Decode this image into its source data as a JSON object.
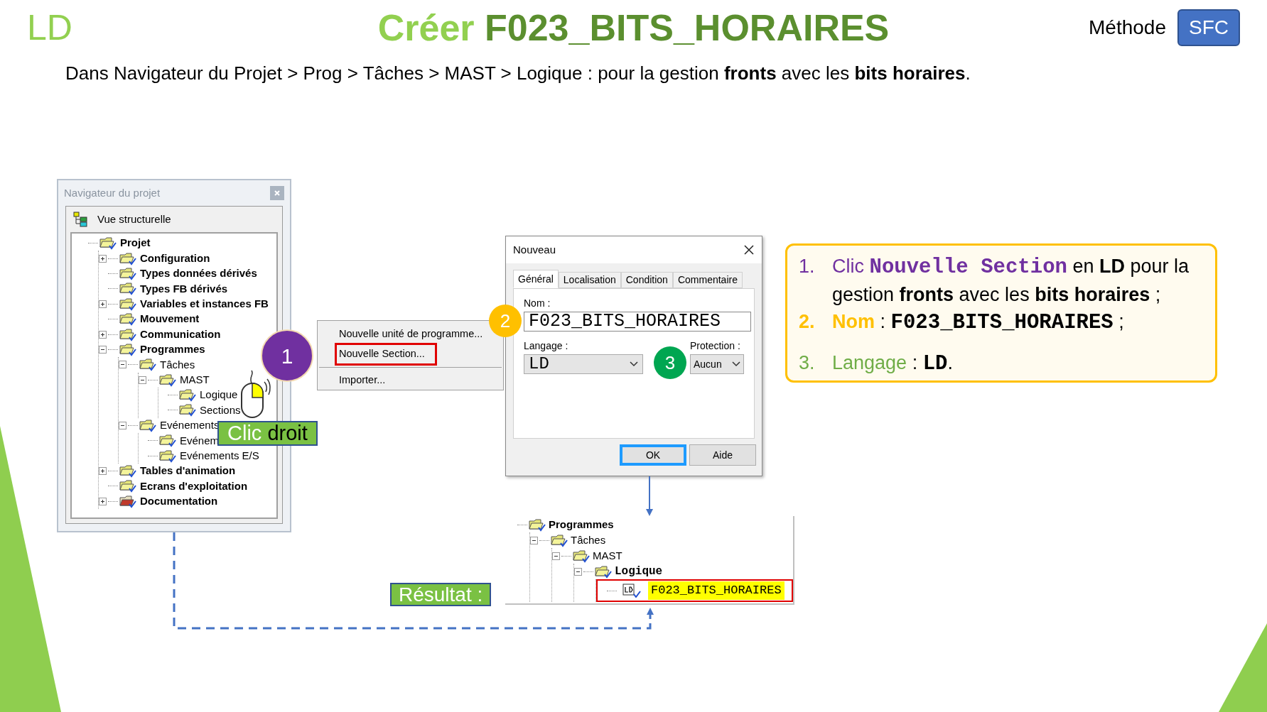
{
  "header": {
    "corner_label": "LD",
    "title_prefix": "Créer",
    "title_name": "F023_BITS_HORAIRES",
    "method_label": "Méthode",
    "method_button": "SFC"
  },
  "subtitle": "Dans Navigateur du Projet > Prog > Tâches > MAST > Logique : pour la gestion **fronts** avec les **bits horaires**.",
  "navigator": {
    "title": "Navigateur du projet",
    "view_label": "Vue structurelle",
    "tree": [
      {
        "label": "Projet",
        "kind": "folder",
        "collapsed": false,
        "children": [
          {
            "label": "Configuration",
            "kind": "folder",
            "collapsed": true
          },
          {
            "label": "Types données dérivés",
            "kind": "folder",
            "collapsed": false
          },
          {
            "label": "Types FB dérivés",
            "kind": "folder",
            "collapsed": false
          },
          {
            "label": "Variables et instances FB",
            "kind": "folder",
            "collapsed": true
          },
          {
            "label": "Mouvement",
            "kind": "folder",
            "collapsed": false
          },
          {
            "label": "Communication",
            "kind": "folder",
            "collapsed": true
          },
          {
            "label": "Programmes",
            "kind": "folder",
            "collapsed": false,
            "children": [
              {
                "label": "Tâches",
                "kind": "folder",
                "collapsed": false,
                "children": [
                  {
                    "label": "MAST",
                    "kind": "folder",
                    "collapsed": false,
                    "children": [
                      {
                        "label": "Logique",
                        "kind": "folder",
                        "collapsed": false
                      },
                      {
                        "label": "Sections",
                        "kind": "folder",
                        "collapsed": false
                      }
                    ]
                  }
                ]
              },
              {
                "label": "Evénements",
                "kind": "folder",
                "collapsed": false,
                "children": [
                  {
                    "label": "Evénem",
                    "kind": "folder",
                    "collapsed": false
                  },
                  {
                    "label": "Evénements E/S",
                    "kind": "folder",
                    "collapsed": false
                  }
                ]
              }
            ]
          },
          {
            "label": "Tables d'animation",
            "kind": "folder",
            "collapsed": true
          },
          {
            "label": "Ecrans d'exploitation",
            "kind": "folder",
            "collapsed": false
          },
          {
            "label": "Documentation",
            "kind": "documentation",
            "collapsed": true
          }
        ]
      }
    ]
  },
  "context_menu": {
    "items": [
      {
        "label": "Nouvelle unité de programme...",
        "highlighted": false,
        "separator_before": false
      },
      {
        "label": "Nouvelle Section...",
        "highlighted": true,
        "separator_before": false
      },
      {
        "label": "Importer...",
        "highlighted": false,
        "separator_before": true
      }
    ]
  },
  "dialog": {
    "title": "Nouveau",
    "tabs": [
      {
        "label": "Général",
        "selected": true
      },
      {
        "label": "Localisation",
        "selected": false
      },
      {
        "label": "Condition",
        "selected": false
      },
      {
        "label": "Commentaire",
        "selected": false
      }
    ],
    "name_label": "Nom :",
    "name_value": "F023_BITS_HORAIRES",
    "language_label": "Langage :",
    "language_value": "LD",
    "protection_label": "Protection :",
    "protection_value": "Aucun",
    "buttons": [
      {
        "label": "OK",
        "focused": true
      },
      {
        "label": "Aide",
        "focused": false
      }
    ]
  },
  "badges": [
    {
      "number": "1",
      "color": "#7030a0"
    },
    {
      "number": "2",
      "color": "#ffc000"
    },
    {
      "number": "3",
      "color": "#00a651"
    }
  ],
  "right_click_label": {
    "first": "Clic",
    "second": "droit"
  },
  "result_label": "Résultat :",
  "result_tree": [
    {
      "label": "Programmes",
      "kind": "folder",
      "collapsed": false,
      "highlighted": false,
      "children": [
        {
          "label": "Tâches",
          "kind": "folder",
          "collapsed": false,
          "highlighted": false,
          "children": [
            {
              "label": "MAST",
              "kind": "folder",
              "collapsed": false,
              "highlighted": false,
              "children": [
                {
                  "label": "Logique",
                  "kind": "folder",
                  "collapsed": false,
                  "highlighted": false,
                  "children": [
                    {
                      "label": "F023_BITS_HORAIRES",
                      "kind": "section",
                      "collapsed": false,
                      "highlighted": true
                    }
                  ]
                }
              ]
            }
          ]
        }
      ]
    }
  ],
  "instructions": [
    {
      "number": "1.",
      "color": "#7030a0",
      "parts": [
        {
          "kind": "lead",
          "text": "Clic "
        },
        {
          "kind": "code_lead",
          "text": "Nouvelle Section"
        },
        {
          "kind": "plain",
          "text": " en **LD** pour la gestion **fronts** avec les **bits horaires** ;"
        }
      ]
    },
    {
      "number": "2.",
      "color": "#ffc000",
      "parts": [
        {
          "kind": "lead_bold",
          "text": "Nom"
        },
        {
          "kind": "plain",
          "text": " : "
        },
        {
          "kind": "code",
          "text": "F023_BITS_HORAIRES"
        },
        {
          "kind": "plain",
          "text": " ;"
        }
      ]
    },
    {
      "number": "3.",
      "color": "#70ad47",
      "parts": [
        {
          "kind": "lead",
          "text": "Langage"
        },
        {
          "kind": "plain",
          "text": " : "
        },
        {
          "kind": "code",
          "text": "LD"
        },
        {
          "kind": "plain",
          "text": "."
        }
      ]
    }
  ]
}
